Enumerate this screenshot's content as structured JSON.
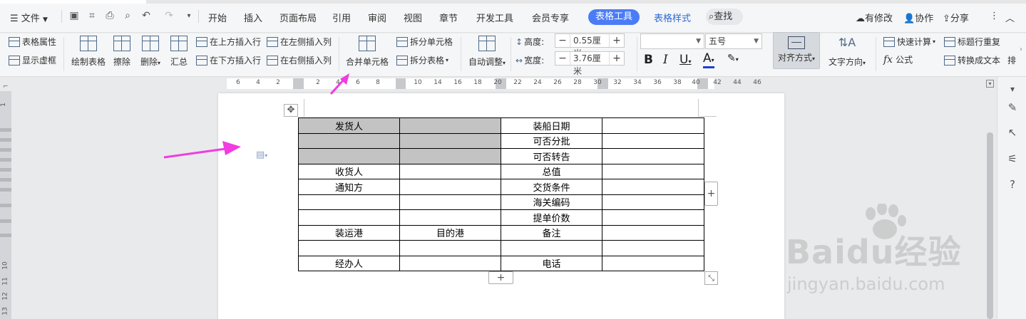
{
  "menu": {
    "file_label": "文件",
    "items": [
      "开始",
      "插入",
      "页面布局",
      "引用",
      "审阅",
      "视图",
      "章节",
      "开发工具",
      "会员专享"
    ],
    "active_tab": "表格工具",
    "second_tab": "表格样式",
    "search_label": "查找",
    "right_items": [
      "有修改",
      "协作",
      "分享"
    ]
  },
  "ribbon": {
    "table_props": "表格属性",
    "show_gridlines": "显示虚框",
    "draw_table": "绘制表格",
    "erase": "擦除",
    "delete": "删除",
    "summary": "汇总",
    "insert_row_above": "在上方插入行",
    "insert_row_below": "在下方插入行",
    "insert_col_left": "在左侧插入列",
    "insert_col_right": "在右侧插入列",
    "merge_cells": "合并单元格",
    "split_cells": "拆分单元格",
    "split_table": "拆分表格",
    "auto_fit": "自动调整",
    "height_label": "高度:",
    "height_value": "0.55厘米",
    "width_label": "宽度:",
    "width_value": "3.76厘米",
    "font_name": "",
    "font_size": "五号",
    "bold": "B",
    "italic": "I",
    "underline": "U",
    "font_color": "A",
    "align": "对齐方式",
    "text_direction": "文字方向",
    "quick_calc": "快速计算",
    "formula": "公式",
    "repeat_header": "标题行重复",
    "convert_to_text": "转换成文本",
    "sort_partial": "排"
  },
  "ruler": {
    "ticks": [
      "6",
      "4",
      "2",
      "2",
      "4",
      "6",
      "8",
      "10",
      "14",
      "16",
      "18",
      "20",
      "22",
      "24",
      "26",
      "28",
      "30",
      "32",
      "34",
      "36",
      "38",
      "40",
      "42",
      "44",
      "46"
    ],
    "vticks": [
      "1",
      "10",
      "11",
      "12",
      "13"
    ]
  },
  "table": {
    "rows": [
      [
        {
          "t": "发货人",
          "s": true
        },
        {
          "t": "",
          "s": true
        },
        {
          "t": "装船日期",
          "s": false
        },
        {
          "t": "",
          "s": false
        }
      ],
      [
        {
          "t": "",
          "s": true
        },
        {
          "t": "",
          "s": true
        },
        {
          "t": "可否分批",
          "s": false
        },
        {
          "t": "",
          "s": false
        }
      ],
      [
        {
          "t": "",
          "s": true
        },
        {
          "t": "",
          "s": true
        },
        {
          "t": "可否转告",
          "s": false
        },
        {
          "t": "",
          "s": false
        }
      ],
      [
        {
          "t": "收货人",
          "s": false
        },
        {
          "t": "",
          "s": false
        },
        {
          "t": "总值",
          "s": false
        },
        {
          "t": "",
          "s": false
        }
      ],
      [
        {
          "t": "通知方",
          "s": false
        },
        {
          "t": "",
          "s": false
        },
        {
          "t": "交货条件",
          "s": false
        },
        {
          "t": "",
          "s": false
        }
      ],
      [
        {
          "t": "",
          "s": false
        },
        {
          "t": "",
          "s": false
        },
        {
          "t": "海关编码",
          "s": false
        },
        {
          "t": "",
          "s": false
        }
      ],
      [
        {
          "t": "",
          "s": false
        },
        {
          "t": "",
          "s": false
        },
        {
          "t": "提单价数",
          "s": false
        },
        {
          "t": "",
          "s": false
        }
      ],
      [
        {
          "t": "装运港",
          "s": false
        },
        {
          "t": "目的港",
          "s": false
        },
        {
          "t": "备注",
          "s": false
        },
        {
          "t": "",
          "s": false
        }
      ],
      [
        {
          "t": "",
          "s": false
        },
        {
          "t": "",
          "s": false
        },
        {
          "t": "",
          "s": false
        },
        {
          "t": "",
          "s": false
        }
      ],
      [
        {
          "t": "经办人",
          "s": false
        },
        {
          "t": "",
          "s": false
        },
        {
          "t": "电话",
          "s": false
        },
        {
          "t": "",
          "s": false
        }
      ]
    ]
  },
  "watermark": {
    "line1": "Baidu经验",
    "line2": "jingyan.baidu.com"
  },
  "colors": {
    "accent": "#4a7cf7",
    "arrow": "#f03ce0",
    "shade": "#c3c3c3"
  }
}
